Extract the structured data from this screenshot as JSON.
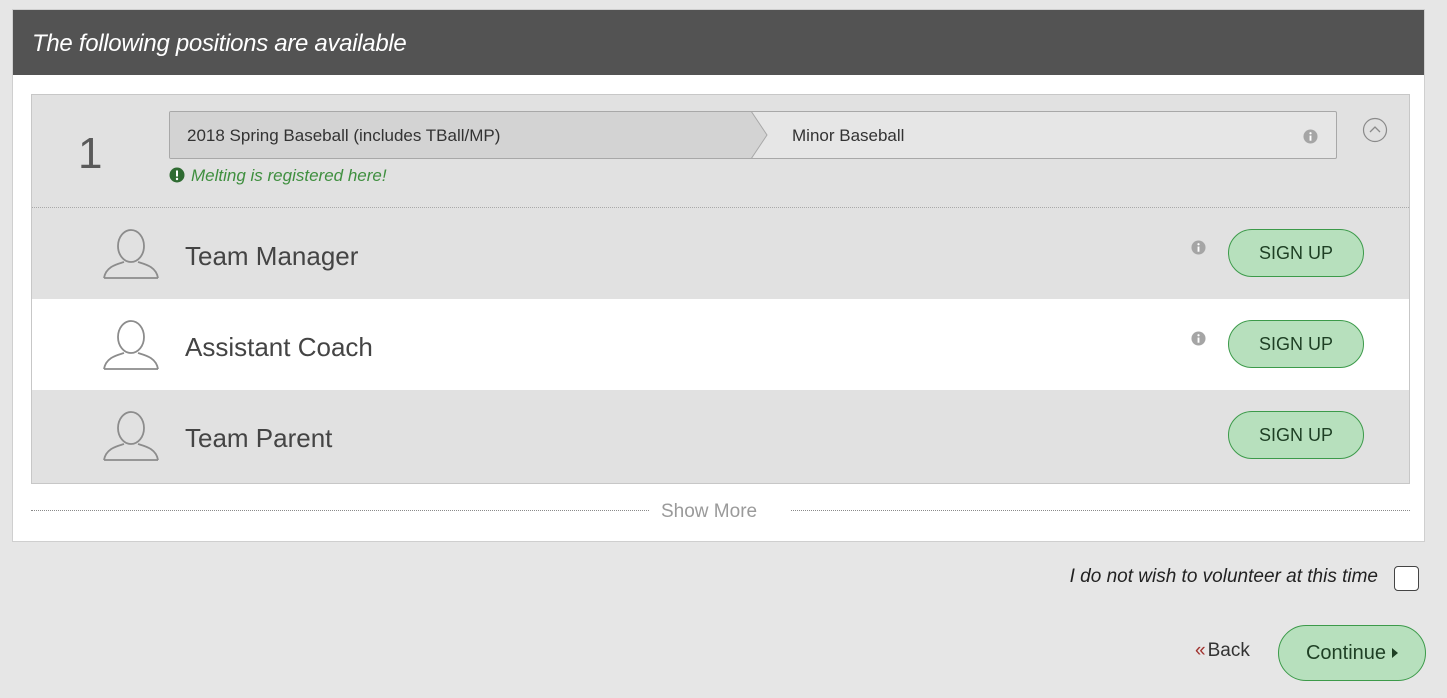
{
  "header": {
    "title": "The following positions are available"
  },
  "group": {
    "number": "1",
    "breadcrumb": [
      "2018 Spring Baseball (includes TBall/MP)",
      "Minor Baseball"
    ],
    "registered_note": "Melting is registered here!",
    "roles": [
      {
        "name": "Team Manager",
        "has_info": true,
        "action": "SIGN UP"
      },
      {
        "name": "Assistant Coach",
        "has_info": true,
        "action": "SIGN UP"
      },
      {
        "name": "Team Parent",
        "has_info": false,
        "action": "SIGN UP"
      }
    ]
  },
  "show_more": "Show More",
  "optout": {
    "label": "I do not wish to volunteer at this time",
    "checked": false
  },
  "nav": {
    "back_label": "Back",
    "back_chevron": "«",
    "continue_label": "Continue"
  },
  "colors": {
    "header_bg": "#535353",
    "button_bg": "#b7e0bd",
    "button_border": "#3c9a4a",
    "success_text": "#3f8f3f",
    "back_chevron": "#a0322e"
  }
}
